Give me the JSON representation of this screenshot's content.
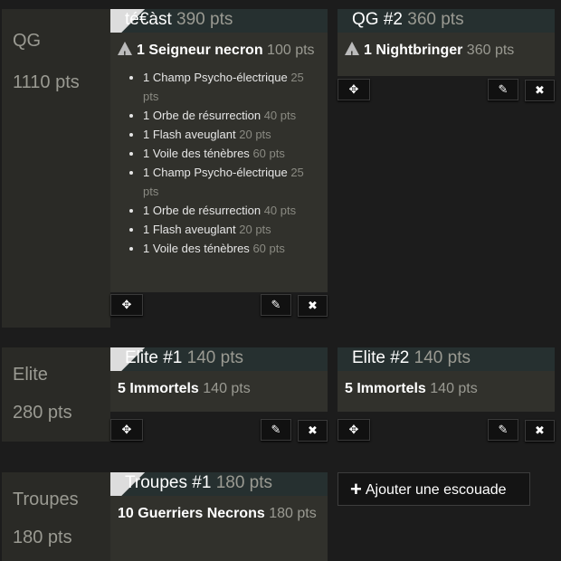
{
  "categories": {
    "qg": {
      "name": "QG",
      "points": "1110 pts"
    },
    "elite": {
      "name": "Elite",
      "points": "280 pts"
    },
    "troupes": {
      "name": "Troupes",
      "points": "180 pts"
    }
  },
  "squads": {
    "qg1": {
      "title": "té€àst",
      "points": "390 pts",
      "unit": {
        "name": "1 Seigneur necron",
        "points": "100 pts",
        "warning": true
      },
      "upgrades": [
        {
          "name": "1 Champ Psycho-électrique",
          "points": "25 pts"
        },
        {
          "name": "1 Orbe de résurrection",
          "points": "40 pts"
        },
        {
          "name": "1 Flash aveuglant",
          "points": "20 pts"
        },
        {
          "name": "1 Voile des ténèbres",
          "points": "60 pts"
        },
        {
          "name": "1 Champ Psycho-électrique",
          "points": "25 pts"
        },
        {
          "name": "1 Orbe de résurrection",
          "points": "40 pts"
        },
        {
          "name": "1 Flash aveuglant",
          "points": "20 pts"
        },
        {
          "name": "1 Voile des ténèbres",
          "points": "60 pts"
        }
      ]
    },
    "qg2": {
      "title": "QG #2",
      "points": "360 pts",
      "unit": {
        "name": "1 Nightbringer",
        "points": "360 pts",
        "warning": true
      }
    },
    "elite1": {
      "title": "Elite #1",
      "points": "140 pts",
      "unit": {
        "name": "5 Immortels",
        "points": "140 pts"
      }
    },
    "elite2": {
      "title": "Elite #2",
      "points": "140 pts",
      "unit": {
        "name": "5 Immortels",
        "points": "140 pts"
      }
    },
    "troupes1": {
      "title": "Troupes #1",
      "points": "180 pts",
      "unit": {
        "name": "10 Guerriers Necrons",
        "points": "180 pts"
      }
    }
  },
  "buttons": {
    "move_icon": "✥",
    "edit_icon": "✎",
    "delete_icon": "✖"
  },
  "icons": {
    "warning": "warning-triangle-icon",
    "move": "move-arrows-icon",
    "edit": "pencil-icon",
    "delete": "close-icon",
    "add": "plus-icon"
  },
  "add_squad": {
    "icon": "+",
    "label": "Ajouter une escouade"
  }
}
